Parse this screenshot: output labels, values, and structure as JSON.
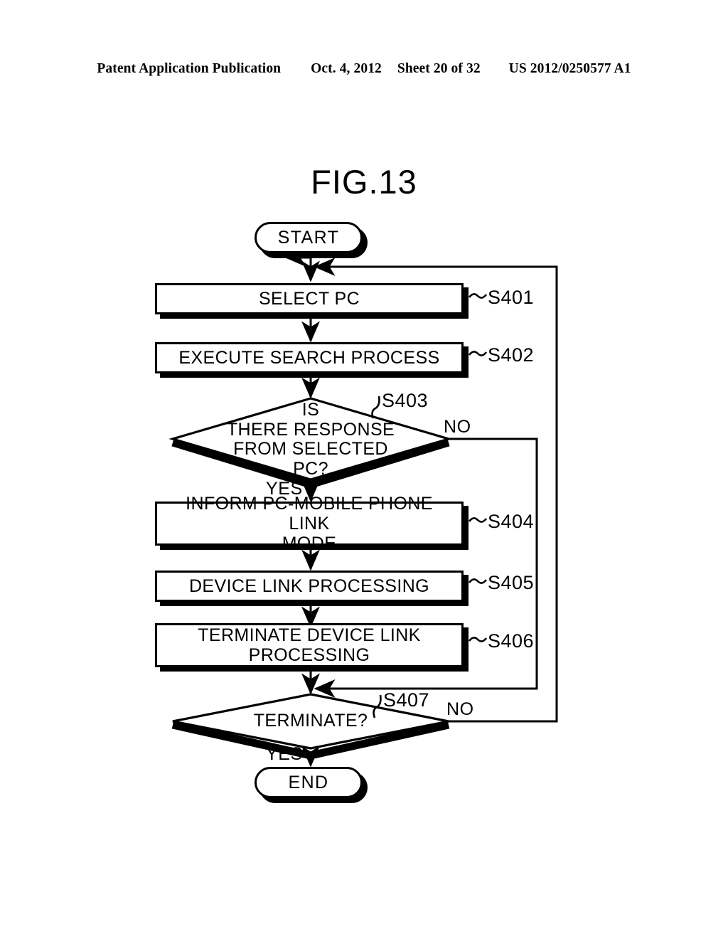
{
  "header": {
    "publication": "Patent Application Publication",
    "date": "Oct. 4, 2012",
    "sheet": "Sheet 20 of 32",
    "patent_number": "US 2012/0250577 A1"
  },
  "figure": {
    "title": "FIG.13"
  },
  "flowchart": {
    "nodes": [
      {
        "id": "start",
        "type": "terminator",
        "label": "START"
      },
      {
        "id": "s401",
        "type": "process",
        "label": "SELECT PC",
        "ref": "S401"
      },
      {
        "id": "s402",
        "type": "process",
        "label": "EXECUTE SEARCH PROCESS",
        "ref": "S402"
      },
      {
        "id": "s403",
        "type": "decision",
        "label": "IS\nTHERE RESPONSE\nFROM SELECTED\nPC?",
        "ref": "S403"
      },
      {
        "id": "s404",
        "type": "process",
        "label": "INFORM PC-MOBILE PHONE LINK\nMODE",
        "ref": "S404"
      },
      {
        "id": "s405",
        "type": "process",
        "label": "DEVICE LINK PROCESSING",
        "ref": "S405"
      },
      {
        "id": "s406",
        "type": "process",
        "label": "TERMINATE DEVICE LINK\nPROCESSING",
        "ref": "S406"
      },
      {
        "id": "s407",
        "type": "decision",
        "label": "TERMINATE?",
        "ref": "S407"
      },
      {
        "id": "end",
        "type": "terminator",
        "label": "END"
      }
    ],
    "branch_labels": {
      "s403_yes": "YES",
      "s403_no": "NO",
      "s407_yes": "YES",
      "s407_no": "NO"
    },
    "colors": {
      "stroke": "#000000",
      "fill": "#ffffff"
    }
  }
}
